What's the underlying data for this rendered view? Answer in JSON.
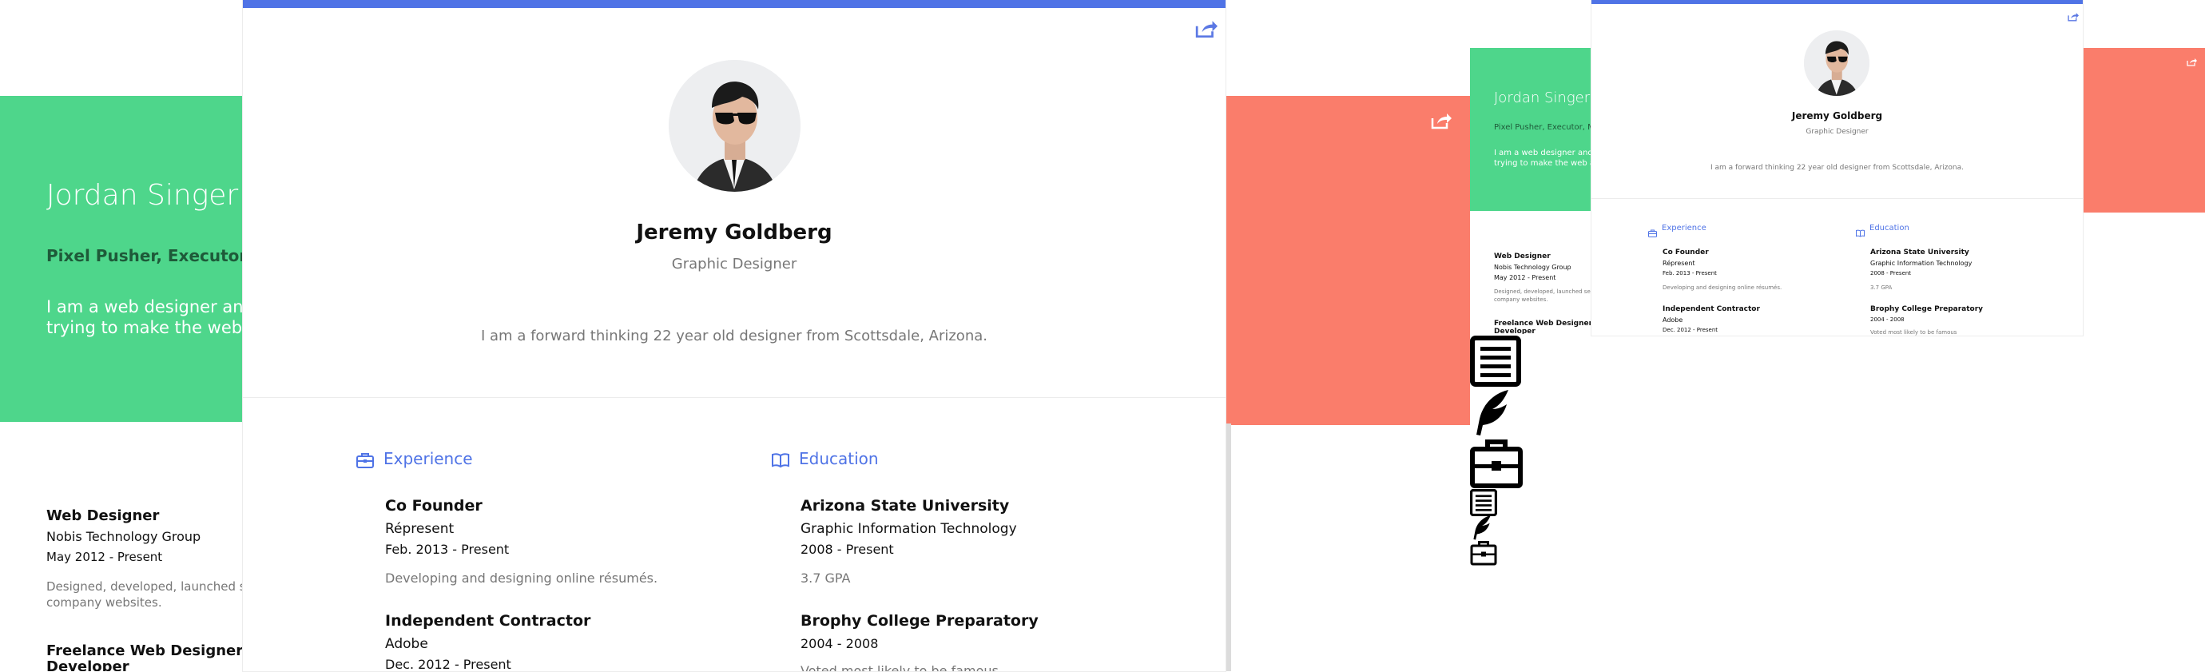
{
  "left": {
    "name": "Jordan Singer",
    "subtitle": "Pixel Pusher, Executor, M",
    "bio_line1": "I am a web designer and de",
    "bio_line2": "trying to make the web a b",
    "jobs": [
      {
        "title": "Web Designer",
        "company": "Nobis Technology Group",
        "dates": "May 2012 - Present",
        "desc_line1": "Designed, developed, launched seve",
        "desc_line2": "company websites."
      },
      {
        "title_line1": "Freelance Web Designer and",
        "title_line2": "Developer"
      }
    ]
  },
  "main": {
    "name": "Jeremy Goldberg",
    "role": "Graphic Designer",
    "bio": "I am a forward thinking 22 year old designer from Scottsdale, Arizona.",
    "experience": {
      "heading": "Experience",
      "items": [
        {
          "title": "Co Founder",
          "org": "Répresent",
          "dates": "Feb. 2013 - Present",
          "desc": "Developing and designing online résumés."
        },
        {
          "title": "Independent Contractor",
          "org": "Adobe",
          "dates": "Dec. 2012 - Present"
        }
      ]
    },
    "education": {
      "heading": "Education",
      "items": [
        {
          "title": "Arizona State University",
          "org": "Graphic Information Technology",
          "dates": "2008 - Present",
          "desc": "3.7 GPA"
        },
        {
          "title": "Brophy College Preparatory",
          "dates": "2004 - 2008",
          "desc": "Voted most likely to be famous"
        }
      ]
    }
  },
  "mini_left": {
    "name": "Jordan Singer",
    "subtitle": "Pixel Pusher, Executor, M",
    "bio_line1": "I am a web designer and de",
    "bio_line2": "trying to make the web a b",
    "jobs": [
      {
        "title": "Web Designer",
        "company": "Nobis Technology Group",
        "dates": "May 2012 - Present",
        "desc_line1": "Designed, developed, launched seve",
        "desc_line2": "company websites."
      },
      {
        "title_line1": "Freelance Web Designer and",
        "title_line2": "Developer"
      }
    ]
  },
  "mini_main": {
    "name": "Jeremy Goldberg",
    "role": "Graphic Designer",
    "bio": "I am a forward thinking 22 year old designer from Scottsdale, Arizona.",
    "experience": {
      "heading": "Experience",
      "items": [
        {
          "title": "Co Founder",
          "org": "Répresent",
          "dates": "Feb. 2013 - Present",
          "desc": "Developing and designing online résumés."
        },
        {
          "title": "Independent Contractor",
          "org": "Adobe",
          "dates": "Dec. 2012 - Present"
        }
      ]
    },
    "education": {
      "heading": "Education",
      "items": [
        {
          "title": "Arizona State University",
          "org": "Graphic Information Technology",
          "dates": "2008 - Present",
          "desc": "3.7 GPA"
        },
        {
          "title": "Brophy College Preparatory",
          "dates": "2004 - 2008",
          "desc": "Voted most likely to be famous"
        }
      ]
    }
  },
  "icons": [
    "share-icon",
    "briefcase-icon",
    "book-icon",
    "document-icon",
    "quill-icon"
  ],
  "colors": {
    "green": "#4ed68b",
    "coral": "#fa7d6b",
    "blue": "#4f73e6"
  }
}
